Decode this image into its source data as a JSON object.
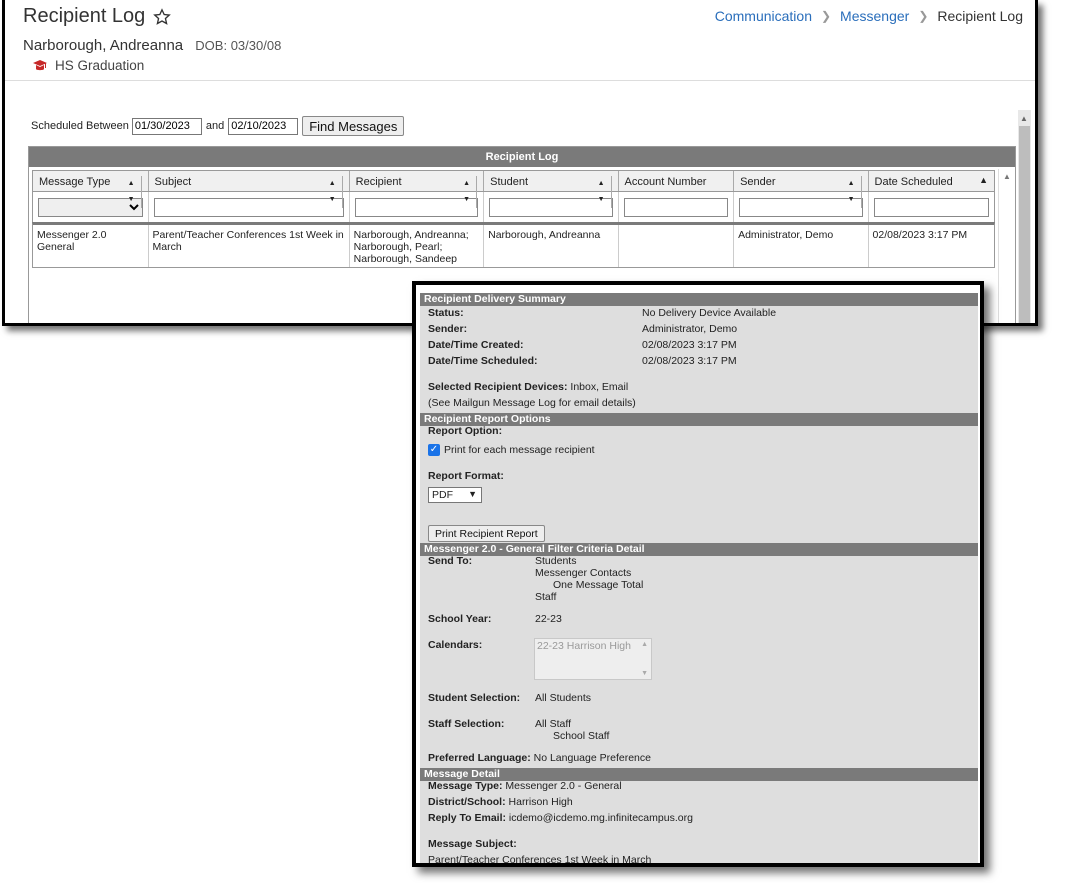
{
  "header": {
    "title": "Recipient Log",
    "breadcrumb": [
      "Communication",
      "Messenger",
      "Recipient Log"
    ],
    "student_name": "Narborough, Andreanna",
    "dob": "DOB: 03/30/08",
    "program": "HS Graduation"
  },
  "filter": {
    "label": "Scheduled Between",
    "start": "01/30/2023",
    "and_label": "and",
    "end": "02/10/2023",
    "button": "Find Messages"
  },
  "grid": {
    "title": "Recipient Log",
    "columns": [
      "Message Type",
      "Subject",
      "Recipient",
      "Student",
      "Account Number",
      "Sender",
      "Date Scheduled"
    ],
    "rows": [
      {
        "message_type": "Messenger 2.0 General",
        "subject": "Parent/Teacher Conferences 1st Week in March",
        "recipient": "Narborough, Andreanna; Narborough, Pearl; Narborough, Sandeep",
        "student": "Narborough, Andreanna",
        "account": "",
        "sender": "Administrator, Demo",
        "date": "02/08/2023 3:17 PM"
      }
    ]
  },
  "detail": {
    "summary_title": "Recipient Delivery Summary",
    "status_label": "Status:",
    "status_value": "No Delivery Device Available",
    "sender_label": "Sender:",
    "sender_value": "Administrator, Demo",
    "created_label": "Date/Time Created:",
    "created_value": "02/08/2023 3:17 PM",
    "scheduled_label": "Date/Time Scheduled:",
    "scheduled_value": "02/08/2023 3:17 PM",
    "devices_label": "Selected Recipient Devices:",
    "devices_value": "Inbox, Email",
    "mailgun_note": "(See Mailgun Message Log for email details)",
    "options_title": "Recipient Report Options",
    "report_option_label": "Report Option:",
    "print_each_label": "Print for each message recipient",
    "report_format_label": "Report Format:",
    "report_format_value": "PDF",
    "print_button": "Print Recipient Report",
    "criteria_title": "Messenger 2.0 - General Filter Criteria Detail",
    "send_to_label": "Send To:",
    "send_to": [
      "Students",
      "Messenger Contacts",
      "One Message Total",
      "Staff"
    ],
    "school_year_label": "School Year:",
    "school_year_value": "22-23",
    "calendars_label": "Calendars:",
    "calendars_value": "22-23 Harrison High",
    "student_selection_label": "Student Selection:",
    "student_selection_value": "All Students",
    "staff_selection_label": "Staff Selection:",
    "staff_selection": [
      "All Staff",
      "School Staff"
    ],
    "language_label": "Preferred Language:",
    "language_value": "No Language Preference",
    "message_detail_title": "Message Detail",
    "message_type_label": "Message Type:",
    "message_type_value": "Messenger 2.0 - General",
    "district_label": "District/School:",
    "district_value": "Harrison High",
    "reply_label": "Reply To Email:",
    "reply_value": "icdemo@icdemo.mg.infinitecampus.org",
    "subject_label": "Message Subject:",
    "subject_value": "Parent/Teacher Conferences 1st Week in March"
  },
  "colors": {
    "link": "#2a6ebb",
    "section_bar": "#7a7a7a",
    "panel_bg": "#dedede",
    "grad_icon": "#c62828"
  },
  "icons": [
    "star-outline-icon",
    "graduation-icon",
    "sort-icon",
    "chevron-right-icon",
    "checkbox-checked-icon"
  ]
}
